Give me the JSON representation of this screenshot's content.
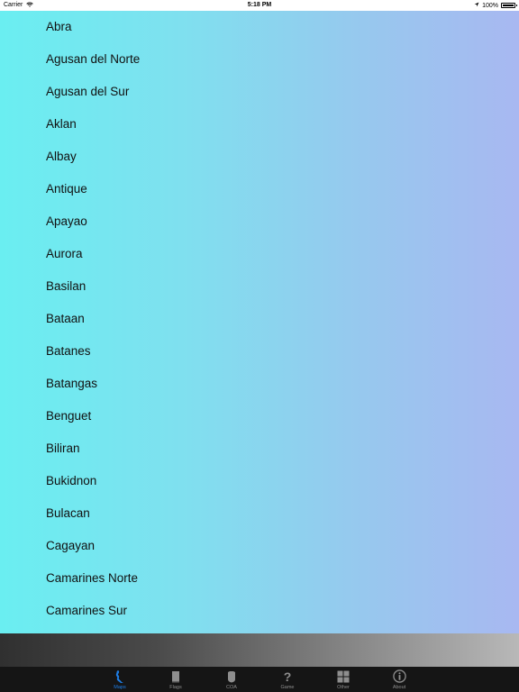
{
  "status_bar": {
    "carrier": "Carrier",
    "time": "5:18 PM",
    "battery": "100%"
  },
  "provinces": [
    "Abra",
    "Agusan del Norte",
    "Agusan del Sur",
    "Aklan",
    "Albay",
    "Antique",
    "Apayao",
    "Aurora",
    "Basilan",
    "Bataan",
    "Batanes",
    "Batangas",
    "Benguet",
    "Biliran",
    "Bukidnon",
    "Bulacan",
    "Cagayan",
    "Camarines Norte",
    "Camarines Sur"
  ],
  "tabs": [
    {
      "label": "Maps",
      "icon": "map-pin-icon",
      "active": true
    },
    {
      "label": "Flags",
      "icon": "flag-icon",
      "active": false
    },
    {
      "label": "COA",
      "icon": "shield-icon",
      "active": false
    },
    {
      "label": "Game",
      "icon": "question-icon",
      "active": false
    },
    {
      "label": "Other",
      "icon": "grid-icon",
      "active": false
    },
    {
      "label": "About",
      "icon": "info-icon",
      "active": false
    }
  ],
  "colors": {
    "accent": "#1e7ee6",
    "gradient_left": "#6aeef1",
    "gradient_right": "#a8b8f1"
  }
}
